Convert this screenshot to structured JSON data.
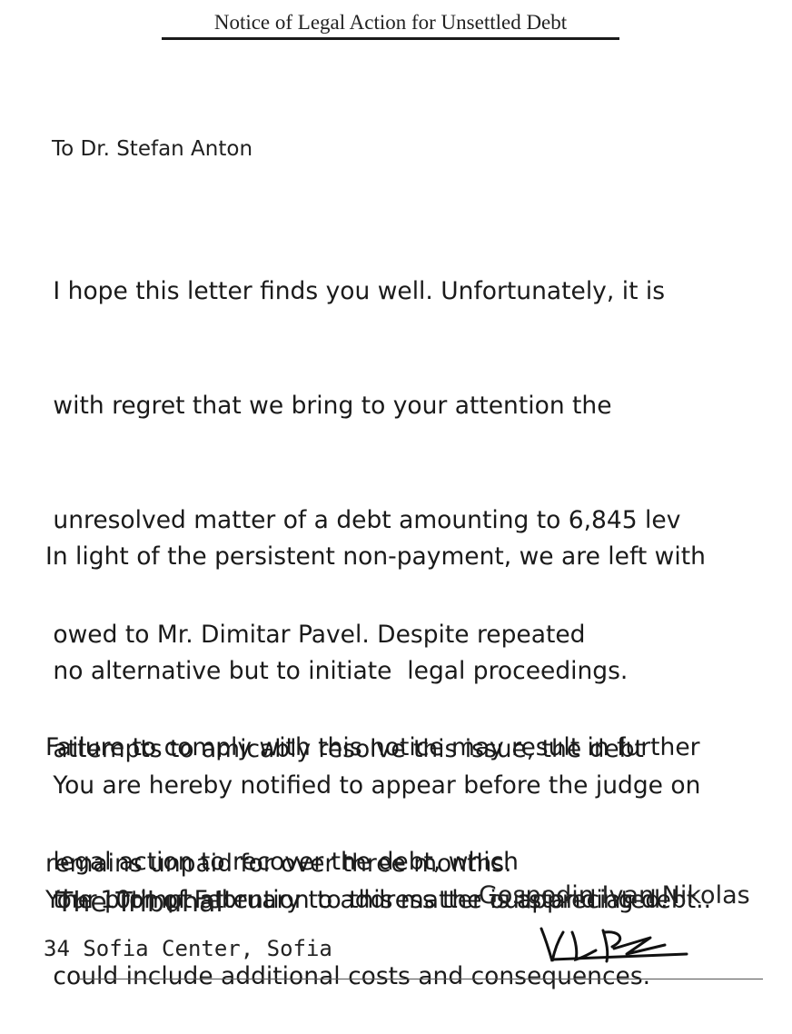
{
  "title": "Notice of Legal Action for Unsettled Debt",
  "salutation": "To Dr. Stefan Anton",
  "paragraphs": [
    [
      " I hope this letter finds you well. Unfortunately, it is",
      " with regret that we bring to your attention the",
      " unresolved matter of a debt amounting to 6,845 lev",
      " owed to Mr. Dimitar Pavel. Despite repeated",
      " attempts to amicably resolve this issue, the debt",
      "remains unpaid for over three months."
    ],
    [
      "In light of the persistent non-payment, we are left with",
      " no alternative but to initiate  legal proceedings.",
      " You are hereby notified to appear before the judge on",
      " the 10th of February to address the outstanding debt.."
    ],
    [
      "Failure to comply with this notice may result in further",
      " legal action to recover the debt, which",
      " could include additional costs and consequences."
    ],
    [
      "Your prompt attention to this matter is appreciated."
    ]
  ],
  "sender": {
    "organization": "The Tribunal",
    "address": "34 Sofia Center, Sofia"
  },
  "signer": {
    "name": "Gospodin Ivan Nikolas",
    "signature_icon": "handwritten-signature-icon"
  }
}
